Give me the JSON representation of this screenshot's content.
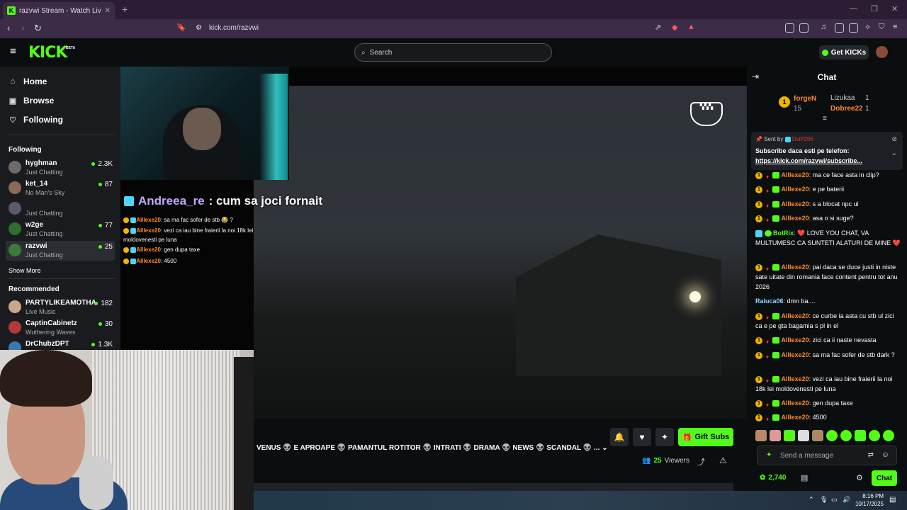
{
  "browser": {
    "tab_title": "razvwi Stream - Watch Live o",
    "url": "kick.com/razvwi"
  },
  "header": {
    "logo": "KICK",
    "beta": "BETA",
    "search_placeholder": "Search",
    "get_kicks": "Get KICKs"
  },
  "sidebar": {
    "nav": [
      {
        "label": "Home",
        "icon": "home-icon"
      },
      {
        "label": "Browse",
        "icon": "browse-icon"
      },
      {
        "label": "Following",
        "icon": "heart-icon"
      }
    ],
    "following_title": "Following",
    "following": [
      {
        "name": "hyghman",
        "category": "Just Chatting",
        "viewers": "2.3K"
      },
      {
        "name": "ket_14",
        "category": "No Man's Sky",
        "viewers": "87"
      },
      {
        "name": "",
        "category": "Just Chatting",
        "viewers": ""
      },
      {
        "name": "w2ge",
        "category": "Just Chatting",
        "viewers": "77"
      },
      {
        "name": "razvwi",
        "category": "Just Chatting",
        "viewers": "25"
      }
    ],
    "show_more": "Show More",
    "recommended_title": "Recommended",
    "recommended": [
      {
        "name": "PARTYLIKEAMOTHA",
        "category": "Live Music",
        "viewers": "182"
      },
      {
        "name": "CaptinCabinetz",
        "category": "Wuthering Waves",
        "viewers": "30"
      },
      {
        "name": "DrChubzDPT",
        "category": "",
        "viewers": "1.3K"
      }
    ]
  },
  "overlay": {
    "highlight_user": "Andreea_re",
    "highlight_text": ": cum sa joci fornait",
    "messages": [
      {
        "user": "Alllexe20",
        "text": ": sa ma fac sofer de stb",
        "extra": "?"
      },
      {
        "user": "Alllexe20",
        "text": ": vezi ca iau bine fraierii la noi 18k lei moldovenesti pe luna",
        "extra": ""
      },
      {
        "user": "Alllexe20",
        "text": ": gen dupa taxe",
        "extra": ""
      },
      {
        "user": "Alllexe20",
        "text": ": 4500",
        "extra": ""
      }
    ]
  },
  "stream": {
    "title": "VENUS 👽 E APROAPE 👽 PAMANTUL ROTITOR 👽 INTRATI 👽 DRAMA 👽 NEWS 👽 SCANDAL 👽 ...",
    "gift_subs": "Gift Subs",
    "viewer_count": "25",
    "viewers_label": "Viewers"
  },
  "chat": {
    "title": "Chat",
    "leaderboard": {
      "rank": "1",
      "top_user": "forgeN",
      "top_value": "15",
      "user2": "Lizukaa",
      "user2_value": "1",
      "user3": "Dobree22",
      "user3_value": "1"
    },
    "pinned": {
      "sent_by": "Sent by",
      "sender": "DviP206",
      "text": "Subscribe daca esti pe telefon:",
      "link": "https://kick.com/razvwi/subscribe..."
    },
    "messages": [
      {
        "user": "Alllexe20",
        "text": ": ma ce face asta in clip?"
      },
      {
        "user": "Alllexe20",
        "text": ": e pe baterii"
      },
      {
        "user": "Alllexe20",
        "text": ": s a blocat npc ul"
      },
      {
        "user": "Alllexe20",
        "text": ": asa o si suge?"
      },
      {
        "user": "BotRix",
        "text": ": ❤️ LOVE YOU CHAT, VA MULTUMESC CA SUNTETI ALATURI DE MINE ❤️"
      },
      {
        "user": "Alllexe20",
        "text": ": pai daca se duce justi in niste sate uitate din romania face content pentru tot anu 2026"
      },
      {
        "user": "Raluca06",
        "text": ": dmn ba...."
      },
      {
        "user": "Alllexe20",
        "text": ": ce curbe ia asta cu stb ul zici ca e pe gta bagamia s pl in el"
      },
      {
        "user": "Alllexe20",
        "text": ": zici ca ii naste nevasta"
      },
      {
        "user": "Alllexe20",
        "text": ": sa ma fac sofer de stb dark ?"
      },
      {
        "user": "Alllexe20",
        "text": ": vezi ca iau bine fraierii la noi 18k lei moldovenesti pe luna"
      },
      {
        "user": "Alllexe20",
        "text": ": gen dupa taxe"
      },
      {
        "user": "Alllexe20",
        "text": ": 4500"
      }
    ],
    "send_placeholder": "Send a message",
    "kicks_balance": "2,740",
    "chat_button": "Chat"
  },
  "taskbar": {
    "time": "8:16 PM",
    "date": "10/17/2025"
  },
  "colors": {
    "accent": "#53fc18",
    "user_orange": "#ff8a2a"
  }
}
